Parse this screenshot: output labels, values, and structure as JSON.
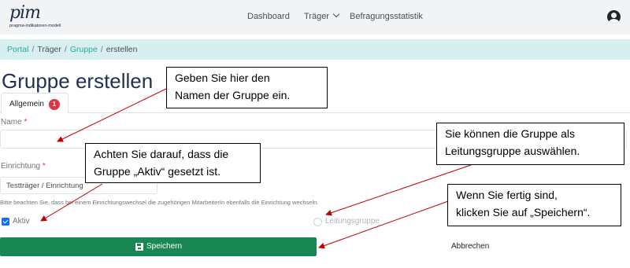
{
  "logo": {
    "wordmark": "pim",
    "subtitle": "pragma-indikatoren-modell"
  },
  "nav": {
    "dashboard": "Dashboard",
    "traeger": "Träger",
    "statistik": "Befragungsstatistik",
    "user_icon": "user-circle-icon"
  },
  "breadcrumb": {
    "portal": "Portal",
    "traeger": "Träger",
    "gruppe": "Gruppe",
    "current": "erstellen",
    "separator": "/"
  },
  "page": {
    "title": "Gruppe erstellen"
  },
  "tabs": {
    "allgemein": "Allgemein",
    "badge": "1"
  },
  "form": {
    "name_label": "Name",
    "name_value": "",
    "required_marker": "*",
    "einrichtung_label": "Einrichtung",
    "einrichtung_value": "Testträger / Einrichtung",
    "hint": "Bitte beachten Sie, dass bei einem Einrichtungswechsel die zugehörigen MitarbeiterIn ebenfalls die Einrichtung wechseln.",
    "aktiv_label": "Aktiv",
    "aktiv_checked": true,
    "leitung_label": "Leitungsgruppe",
    "leitung_checked": false,
    "save_label": "Speichern",
    "cancel_label": "Abbrechen"
  },
  "callouts": {
    "name_line1": "Geben Sie hier den",
    "name_line2": "Namen der Gruppe ein.",
    "aktiv_line1": "Achten Sie darauf, dass die",
    "aktiv_line2": "Gruppe „Aktiv“ gesetzt ist.",
    "leitung_line1": "Sie können die Gruppe als",
    "leitung_line2": "Leitungsgruppe auswählen.",
    "save_line1": "Wenn Sie fertig sind,",
    "save_line2": "klicken Sie auf „Speichern“."
  },
  "colors": {
    "navbar_bg": "#f1f3f4",
    "breadcrumb_bg": "#d8efef",
    "link": "#2aa89a",
    "title": "#1f3050",
    "save_button": "#198754",
    "checkbox": "#0d6efd",
    "badge": "#dc3545",
    "arrow": "#c00000"
  }
}
